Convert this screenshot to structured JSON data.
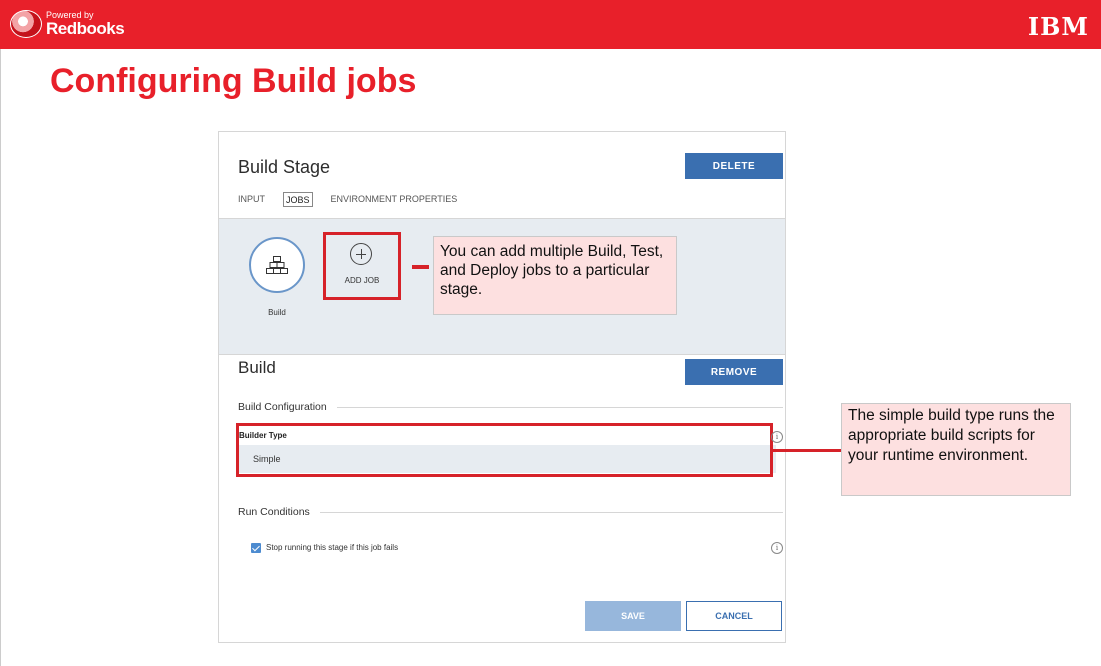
{
  "header": {
    "logo_powered": "Powered by",
    "logo_brand": "Redbooks",
    "company_logo": "IBM",
    "brand_color": "#e8202a"
  },
  "slide": {
    "title": "Configuring Build jobs"
  },
  "panel": {
    "title": "Build Stage",
    "delete_label": "DELETE",
    "tabs": [
      {
        "label": "INPUT",
        "active": false
      },
      {
        "label": "JOBS",
        "active": true
      },
      {
        "label": "ENVIRONMENT PROPERTIES",
        "active": false
      }
    ],
    "jobs": [
      {
        "label": "Build",
        "icon": "build-blocks-icon"
      }
    ],
    "add_job_label": "ADD JOB",
    "add_job_icon": "plus-circle-icon",
    "job_title": "Build",
    "remove_label": "REMOVE",
    "build_configuration_heading": "Build Configuration",
    "builder_type_label": "Builder Type",
    "builder_type_value": "Simple",
    "run_conditions_heading": "Run Conditions",
    "stop_on_fail_label": "Stop running this stage if this job fails",
    "stop_on_fail_checked": true,
    "save_label": "SAVE",
    "cancel_label": "CANCEL",
    "accent_color": "#3a6fb0"
  },
  "callouts": {
    "add_job_note": "You can add multiple Build, Test, and Deploy jobs to a particular stage.",
    "builder_type_note": "The simple build type runs the appropriate build scripts for your runtime environment."
  }
}
